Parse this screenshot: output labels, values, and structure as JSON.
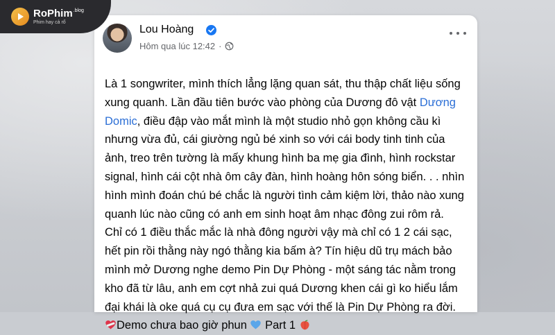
{
  "watermark": {
    "brand": "RoPhim",
    "brand_suffix": ".blog",
    "tagline": "Phim hay cả rổ"
  },
  "post": {
    "author": "Lou Hoàng",
    "verified": true,
    "timestamp": "Hôm qua lúc 12:42",
    "meta_separator": "·",
    "audience_icon": "globe-icon",
    "more_icon": "more-options-icon",
    "lines": [
      {
        "text": "Là 1 songwriter, mình thích lẳng lặng quan sát, thu thập chất liệu sống"
      },
      {
        "text": "xung quanh. Lần đầu tiên bước vào phòng của Dương đô vật ",
        "mention": "Dương"
      },
      {
        "mention": "Domic",
        "text": ", điều đập vào mắt mình là một studio nhỏ gọn không cầu kì"
      },
      {
        "text": "nhưng vừa đủ, cái giường ngủ bé xinh so với cái body tinh tinh của"
      },
      {
        "text": "ảnh, treo trên tường là mấy khung hình ba mẹ gia đình, hình rockstar"
      },
      {
        "text": "signal, hình cái cột nhà ôm cây đàn, hình hoàng hôn sóng biển. . . nhìn"
      },
      {
        "text": "hình mình đoán chú bé chắc là người tình cảm kiệm lời, thảo nào xung"
      },
      {
        "text": "quanh lúc nào cũng có anh em sinh hoạt âm nhạc đông zui rôm rả."
      },
      {
        "text": "Chỉ có 1 điều thắc mắc là nhà đông người vậy mà chỉ có 1 2 cái sạc,"
      },
      {
        "text": "hết pin rồi thằng này ngó thằng kia bấm à? Tín hiệu dũ trụ mách bảo"
      },
      {
        "text": "mình mở Dương nghe demo Pin Dự Phòng - một sáng tác nằm trong"
      },
      {
        "text": "kho đã từ lâu, anh em cợt nhả zui quá Dương khen cái gì ko hiểu lắm"
      },
      {
        "text": "đại khái là oke quá cụ cụ đưa em sạc với thế là Pin Dự Phòng ra đời."
      }
    ],
    "last_line": {
      "emoji_start": "mending-heart-emoji",
      "text_a": "Demo chưa bao giờ phun ",
      "emoji_mid": "blue-heart-emoji",
      "text_b": " Part 1 ",
      "emoji_end": "peach-emoji"
    }
  },
  "colors": {
    "mention": "#2c6fd6",
    "verified": "#1877f2",
    "text": "#050505",
    "meta": "#65676b"
  }
}
